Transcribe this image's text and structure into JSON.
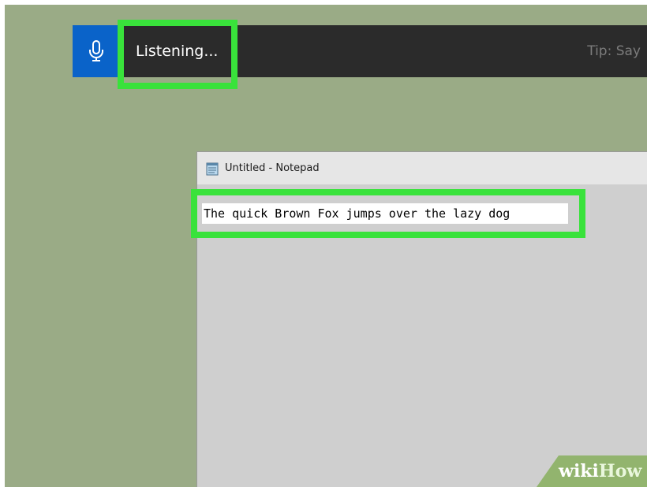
{
  "speech_bar": {
    "status": "Listening...",
    "tip": "Tip: Say",
    "mic_icon": "microphone-icon"
  },
  "notepad": {
    "title": "Untitled - Notepad",
    "icon": "notepad-icon",
    "text": "The quick Brown Fox jumps over the lazy dog"
  },
  "watermark": {
    "wiki": "wiki",
    "how": "How"
  },
  "colors": {
    "desktop": "#9aab86",
    "speech_bar": "#2b2b2b",
    "mic_tile": "#0a63c9",
    "highlight": "#39e23b",
    "notepad_bg": "#cfcfcf",
    "titlebar": "#e6e6e6"
  }
}
